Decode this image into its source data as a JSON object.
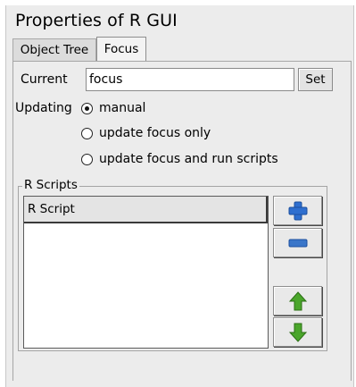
{
  "window": {
    "title": "Properties of R GUI"
  },
  "tabs": [
    {
      "label": "Object Tree",
      "active": false
    },
    {
      "label": "Focus",
      "active": true
    }
  ],
  "focus": {
    "current_label": "Current",
    "current_value": "focus",
    "set_label": "Set",
    "updating_label": "Updating",
    "options": [
      {
        "label": "manual",
        "checked": true
      },
      {
        "label": "update focus only",
        "checked": false
      },
      {
        "label": "update focus and run scripts",
        "checked": false
      }
    ]
  },
  "scripts": {
    "group_label": "R Scripts",
    "column_header": "R Script",
    "rows": [],
    "buttons": {
      "add_icon": "plus-icon",
      "remove_icon": "minus-icon",
      "up_icon": "arrow-up-icon",
      "down_icon": "arrow-down-icon"
    }
  },
  "colors": {
    "add_blue": "#2f6fcf",
    "remove_blue": "#3a76c9",
    "arrow_green": "#4aa62b"
  }
}
